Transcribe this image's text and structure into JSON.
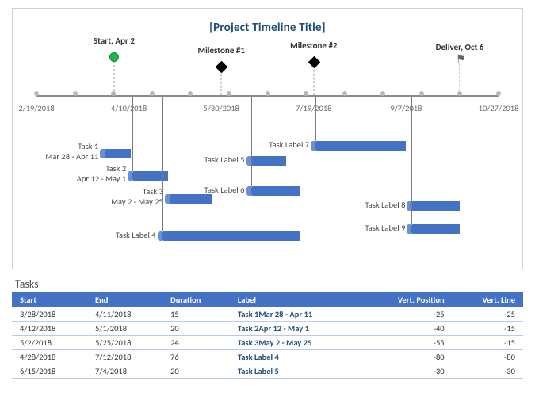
{
  "chart_data": {
    "type": "bar",
    "title": "[Project Timeline Title]",
    "xlabel": "",
    "ylabel": "",
    "axis_ticks": [
      "2/19/2018",
      "4/10/2018",
      "5/30/2018",
      "7/19/2018",
      "9/7/2018",
      "10/27/2018"
    ],
    "milestones": [
      {
        "label": "Start, Apr 2",
        "date": "4/2/2018",
        "marker": "circle"
      },
      {
        "label": "Milestone #1",
        "date": "5/30/2018",
        "marker": "diamond"
      },
      {
        "label": "Milestone #2",
        "date": "7/19/2018",
        "marker": "diamond"
      },
      {
        "label": "Deliver, Oct 6",
        "date": "10/6/2018",
        "marker": "flag"
      }
    ],
    "tasks": [
      {
        "label": "Task 1\nMar 28 - Apr 11",
        "start": "3/28/2018",
        "end": "4/11/2018",
        "vpos": -25
      },
      {
        "label": "Task 2\nApr 12 - May 1",
        "start": "4/12/2018",
        "end": "5/1/2018",
        "vpos": -40
      },
      {
        "label": "Task 3\nMay 2 - May 25",
        "start": "5/2/2018",
        "end": "5/25/2018",
        "vpos": -55
      },
      {
        "label": "Task Label 4",
        "start": "4/28/2018",
        "end": "7/12/2018",
        "vpos": -80
      },
      {
        "label": "Task Label 5",
        "start": "6/15/2018",
        "end": "7/4/2018",
        "vpos": -30
      },
      {
        "label": "Task Label 6",
        "start": "6/15/2018",
        "end": "7/12/2018",
        "vpos": -50
      },
      {
        "label": "Task Label 7",
        "start": "7/20/2018",
        "end": "9/7/2018",
        "vpos": -20
      },
      {
        "label": "Task Label 8",
        "start": "9/10/2018",
        "end": "10/6/2018",
        "vpos": -60
      },
      {
        "label": "Task Label 9",
        "start": "9/10/2018",
        "end": "10/6/2018",
        "vpos": -75
      }
    ]
  },
  "table": {
    "section_title": "Tasks",
    "headers": {
      "start": "Start",
      "end": "End",
      "duration": "Duration",
      "label": "Label",
      "vpos": "Vert. Position",
      "vline": "Vert. Line"
    },
    "rows": [
      {
        "start": "3/28/2018",
        "end": "4/11/2018",
        "duration": "15",
        "label": "Task 1Mar 28 - Apr 11",
        "vpos": "-25",
        "vline": "-25"
      },
      {
        "start": "4/12/2018",
        "end": "5/1/2018",
        "duration": "20",
        "label": "Task 2Apr 12 - May 1",
        "vpos": "-40",
        "vline": "-15"
      },
      {
        "start": "5/2/2018",
        "end": "5/25/2018",
        "duration": "24",
        "label": "Task 3May 2 - May 25",
        "vpos": "-55",
        "vline": "-15"
      },
      {
        "start": "4/28/2018",
        "end": "7/12/2018",
        "duration": "76",
        "label": "Task Label 4",
        "vpos": "-80",
        "vline": "-80"
      },
      {
        "start": "6/15/2018",
        "end": "7/4/2018",
        "duration": "20",
        "label": "Task Label 5",
        "vpos": "-30",
        "vline": "-30"
      }
    ]
  }
}
